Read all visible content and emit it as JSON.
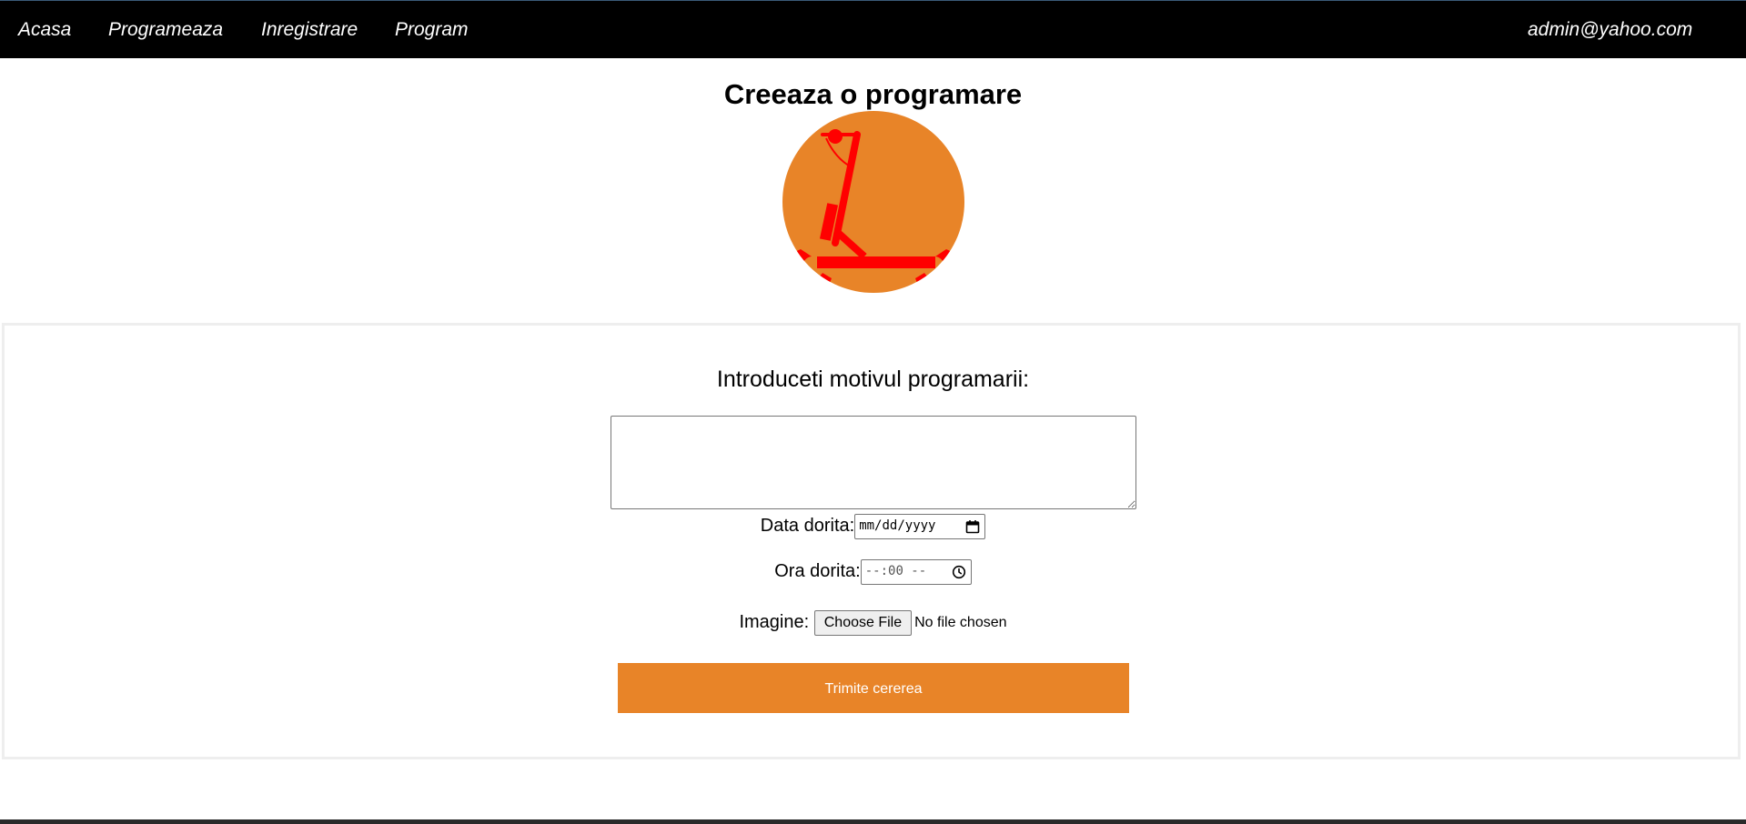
{
  "nav": {
    "links": [
      "Acasa",
      "Programeaza",
      "Inregistrare",
      "Program"
    ],
    "user_email": "admin@yahoo.com"
  },
  "page": {
    "title": "Creeaza o programare"
  },
  "colors": {
    "accent": "#e88428",
    "logo_mark": "#ff0000",
    "navbar": "#000000"
  },
  "logo": {
    "icon": "scooter-wrench-icon"
  },
  "form": {
    "heading": "Introduceti motivul programarii:",
    "reason_value": "",
    "date_label": "Data dorita:",
    "date_placeholder": "mm/dd/yyyy",
    "time_label": "Ora dorita:",
    "time_placeholder": "--:00 --",
    "image_label": "Imagine:",
    "choose_file_label": "Choose File",
    "no_file_text": "No file chosen",
    "submit_label": "Trimite cererea"
  }
}
